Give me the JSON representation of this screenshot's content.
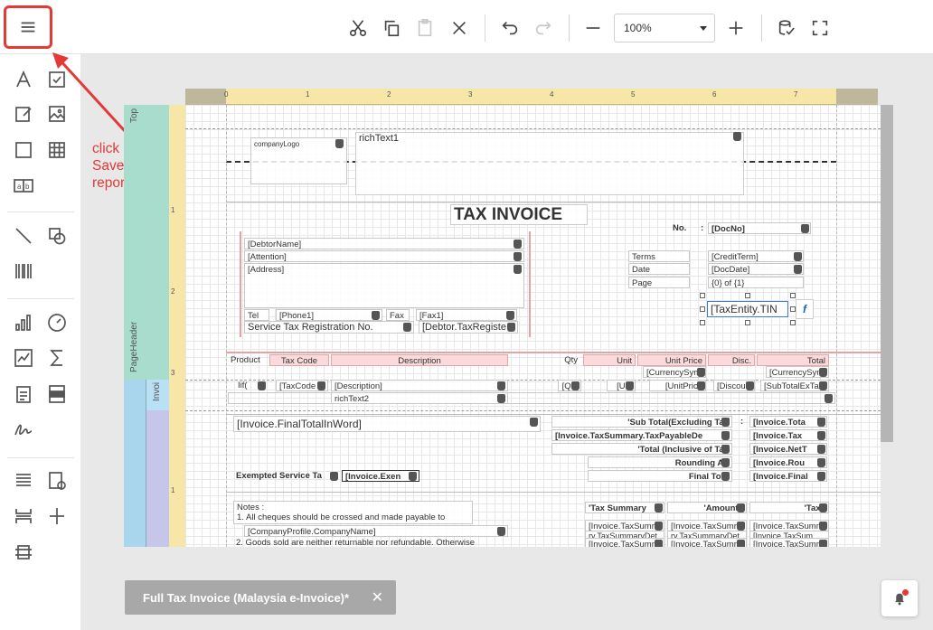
{
  "toolbar": {
    "zoom_value": "100%",
    "items": [
      "cut",
      "copy",
      "paste",
      "delete",
      "undo",
      "redo",
      "zoom-out",
      "zoom-in",
      "run-script",
      "fullscreen"
    ]
  },
  "annotation": {
    "text": "click here and Save As new report",
    "color": "#e53935"
  },
  "toolbox": [
    "label",
    "checkbox",
    "rich-text",
    "picture",
    "panel",
    "table",
    "character-comb",
    "line",
    "shape",
    "barcode",
    "chart",
    "gauge",
    "sparkline",
    "sigma",
    "table-of-contents",
    "pdf-content",
    "signature",
    "page-info",
    "sub-report",
    "page-break",
    "cross-band"
  ],
  "ruler": {
    "top_ticks": [
      "0",
      "1",
      "2",
      "3",
      "4",
      "5",
      "6",
      "7"
    ],
    "left_ticks": [
      "1",
      "2",
      "3",
      "1"
    ]
  },
  "bands": {
    "top": "Top",
    "page_header": "PageHeader",
    "invoice": "Invoi"
  },
  "report": {
    "company_logo": "companyLogo",
    "rich_text1": "richText1",
    "title": "TAX INVOICE",
    "no_label": "No.",
    "colon": ":",
    "doc_no": "[DocNo]",
    "debtor_name": "[DebtorName]",
    "attention": "[Attention]",
    "address": "[Address]",
    "tel_label": "Tel",
    "phone1": "[Phone1]",
    "fax_label": "Fax",
    "fax1": "[Fax1]",
    "service_tax_label": "Service Tax Registration No.",
    "debtor_tax_reg": "[Debtor.TaxRegiste",
    "terms_label": "Terms",
    "credit_term": "[CreditTerm]",
    "date_label": "Date",
    "doc_date": "[DocDate]",
    "page_label": "Page",
    "page_value": "{0} of {1}",
    "tin": "[TaxEntity.TIN",
    "func_icon": "f",
    "col_product": "Product",
    "col_taxcode": "Tax Code",
    "col_description": "Description",
    "col_qty": "Qty",
    "col_unit": "Unit",
    "col_unitprice": "Unit Price",
    "col_disc": "Disc.",
    "col_total": "Total",
    "currency_sym": "[CurrencySym",
    "currency_sym2": "[CurrencySym",
    "row_iif": "Iif(",
    "row_taxcode": "[TaxCode",
    "row_description": "[Description]",
    "row_qty": "[Qty",
    "row_unit": "[Uni",
    "row_unitprice": "[UnitPrice",
    "row_disc": "[Discou",
    "row_subtotal": "[SubTotalExTa",
    "rich_text2": "richText2",
    "final_total_word": "[Invoice.FinalTotalInWord]",
    "sub_total_label": "'Sub Total(Excluding Tax",
    "sub_total_val": "[Invoice.Tota",
    "tax_payable_label": "[Invoice.TaxSummary.TaxPayableDe",
    "tax_payable_val": "[Invoice.Tax",
    "total_incl_label": "'Total (Inclusive of Tax",
    "total_incl_val": "[Invoice.NetT",
    "rounding_label": "Rounding Ad",
    "rounding_val": "[Invoice.Rou",
    "final_total_label": "Final Tota",
    "final_total_val": "[Invoice.Final",
    "exempted_label": "Exempted Service Ta",
    "exempted_val": "[Invoice.Exen",
    "notes_title": "Notes :",
    "notes_1": "1. All cheques should be crossed and made payable to",
    "company_name": "[CompanyProfile.CompanyName]",
    "notes_2": "2. Goods sold are neither returnable nor refundable. Otherwise",
    "tax_summary": "'Tax Summary",
    "amount": "'Amount('",
    "tax": "'Tax('",
    "ts_r1c1": "[Invoice.TaxSumr",
    "ts_r1c2": "[Invoice.TaxSumr",
    "ts_r1c3": "[Invoice.TaxSumr",
    "ts_r2c1": "ry.TaxSummaryDet",
    "ts_r2c2": "ry.TaxSummaryDet",
    "ts_r2c3": "[Invoice.TaxSum",
    "ts_r3c1": "[Invoice.TaxSumr",
    "ts_r3c2": "[Invoice.TaxSumr",
    "ts_r3c3": "[Invoice.TaxSumr"
  },
  "tab": {
    "title": "Full Tax Invoice (Malaysia e-Invoice)*",
    "close": "✕"
  }
}
